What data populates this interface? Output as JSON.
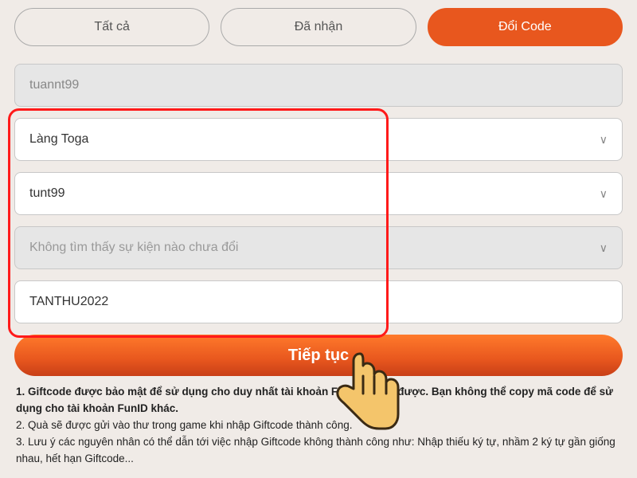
{
  "tabs": {
    "all": "Tất cả",
    "received": "Đã nhận",
    "redeem": "Đổi Code"
  },
  "fields": {
    "username": "tuannt99",
    "server": "Làng Toga",
    "character": "tunt99",
    "event_placeholder": "Không tìm thấy sự kiện nào chưa đổi",
    "code": "TANTHU2022"
  },
  "buttons": {
    "submit": "Tiếp tục"
  },
  "notes": {
    "n1_a": "1. Giftcode được bảo mật để sử dụng cho duy nhất tài khoản F",
    "n1_b": "được. Bạn không thể copy mã code để sử dụng cho tài khoản FunID khác.",
    "n2": "2. Quà sẽ được gửi vào thư trong game khi nhập Giftcode thành công.",
    "n3": "3. Lưu ý các nguyên nhân có thể dẫn tới việc nhập Giftcode không thành công như: Nhập thiếu ký tự, nhầm 2 ký tự gần giống nhau, hết hạn Giftcode..."
  }
}
